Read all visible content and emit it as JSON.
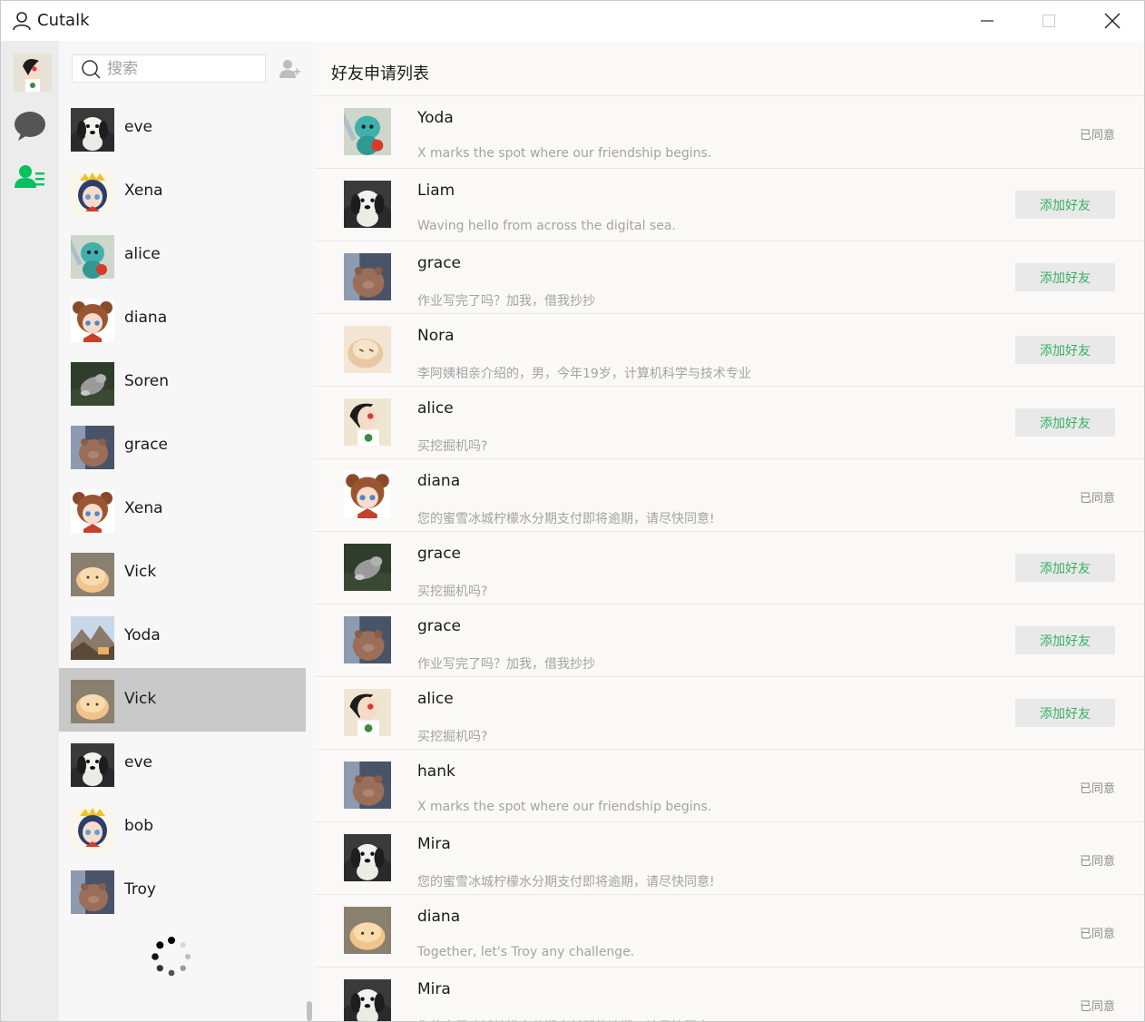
{
  "app": {
    "title": "Cutalk"
  },
  "colors": {
    "accent": "#07c160",
    "add_text": "#35b060",
    "selected_row": "#c9c9c9"
  },
  "icons": {
    "app": "user-outline-icon",
    "nav_chat": "chat-bubble-icon",
    "nav_contacts": "contacts-list-icon",
    "search": "search-icon",
    "add_user": "add-user-icon",
    "loading": "loading-spinner-icon"
  },
  "search": {
    "placeholder": "搜索"
  },
  "contacts": [
    {
      "name": "eve",
      "avatar": "dog"
    },
    {
      "name": "Xena",
      "avatar": "girl-crown"
    },
    {
      "name": "alice",
      "avatar": "figure-teal"
    },
    {
      "name": "diana",
      "avatar": "girl-bear"
    },
    {
      "name": "Soren",
      "avatar": "grey-cat"
    },
    {
      "name": "grace",
      "avatar": "brown-bear"
    },
    {
      "name": "Xena",
      "avatar": "girl-bear"
    },
    {
      "name": "Vick",
      "avatar": "bread"
    },
    {
      "name": "Yoda",
      "avatar": "mountain"
    },
    {
      "name": "Vick",
      "avatar": "bread",
      "selected": true
    },
    {
      "name": "eve",
      "avatar": "dog"
    },
    {
      "name": "bob",
      "avatar": "girl-crown"
    },
    {
      "name": "Troy",
      "avatar": "brown-bear"
    }
  ],
  "main": {
    "title": "好友申请列表",
    "add_label": "添加好友",
    "agreed_label": "已同意",
    "requests": [
      {
        "name": "Yoda",
        "message": "X marks the spot where our friendship begins.",
        "status": "agreed",
        "avatar": "figure-teal"
      },
      {
        "name": "Liam",
        "message": "Waving hello from across the digital sea.",
        "status": "add",
        "avatar": "dog"
      },
      {
        "name": "grace",
        "message": "作业写完了吗？加我，借我抄抄",
        "status": "add",
        "avatar": "brown-bear"
      },
      {
        "name": "Nora",
        "message": "李阿姨相亲介绍的，男，今年19岁，计算机科学与技术专业",
        "status": "add",
        "avatar": "bread-pale"
      },
      {
        "name": "alice",
        "message": "买挖掘机吗?",
        "status": "add",
        "avatar": "girl-clover"
      },
      {
        "name": "diana",
        "message": "您的蜜雪冰城柠檬水分期支付即将逾期，请尽快同意!",
        "status": "agreed",
        "avatar": "girl-bear"
      },
      {
        "name": "grace",
        "message": "买挖掘机吗?",
        "status": "add",
        "avatar": "grey-cat"
      },
      {
        "name": "grace",
        "message": "作业写完了吗？加我，借我抄抄",
        "status": "add",
        "avatar": "brown-bear"
      },
      {
        "name": "alice",
        "message": "买挖掘机吗?",
        "status": "add",
        "avatar": "girl-clover"
      },
      {
        "name": "hank",
        "message": "X marks the spot where our friendship begins.",
        "status": "agreed",
        "avatar": "brown-bear"
      },
      {
        "name": "Mira",
        "message": "您的蜜雪冰城柠檬水分期支付即将逾期，请尽快同意!",
        "status": "agreed",
        "avatar": "dog"
      },
      {
        "name": "diana",
        "message": "Together, let's Troy any challenge.",
        "status": "agreed",
        "avatar": "bread"
      },
      {
        "name": "Mira",
        "message": "您的蜜雪冰城柠檬水分期支付即将逾期，请尽快同意!",
        "status": "agreed",
        "avatar": "dog"
      }
    ]
  }
}
